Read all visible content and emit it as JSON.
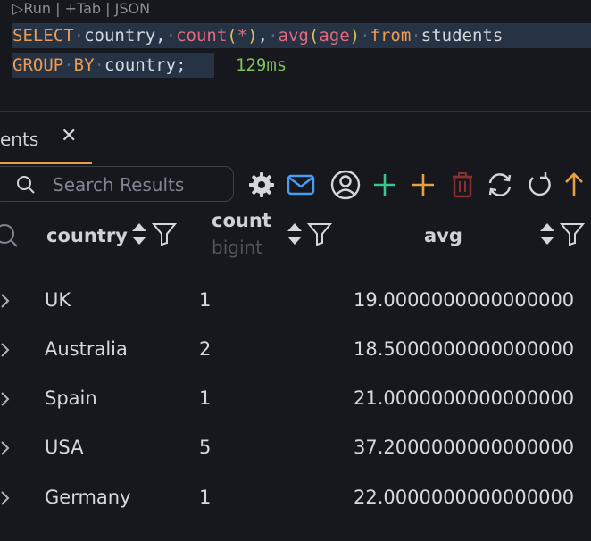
{
  "editor": {
    "codelens": {
      "run": "Run",
      "tab": "Tab",
      "json": "JSON"
    },
    "line1": {
      "select": "SELECT",
      "col": "country,",
      "count_fn": "count",
      "lparen1": "(",
      "star": "*",
      "rparen1": ")",
      "comma": ",",
      "avg_fn": "avg",
      "lparen2": "(",
      "age": "age",
      "rparen2": ")",
      "from": "from",
      "table": "students"
    },
    "line2": {
      "group": "GROUP",
      "by": "BY",
      "col": "country;"
    },
    "exec_time": "129ms"
  },
  "tab": {
    "label": "ents",
    "close": "✕"
  },
  "search": {
    "placeholder": "Search Results"
  },
  "table": {
    "columns": [
      {
        "label": "country",
        "type": ""
      },
      {
        "label": "count",
        "type": "bigint"
      },
      {
        "label": "avg",
        "type": ""
      }
    ],
    "rows": [
      {
        "country": "UK",
        "count": "1",
        "avg": "19.0000000000000000"
      },
      {
        "country": "Australia",
        "count": "2",
        "avg": "18.5000000000000000"
      },
      {
        "country": "Spain",
        "count": "1",
        "avg": "21.0000000000000000"
      },
      {
        "country": "USA",
        "count": "5",
        "avg": "37.2000000000000000"
      },
      {
        "country": "Germany",
        "count": "1",
        "avg": "22.0000000000000000"
      }
    ]
  },
  "colors": {
    "background": "#16181d",
    "keyword": "#ee9b55",
    "function": "#e26a7c",
    "paren": "#e0c04a",
    "exec_time": "#7ec25a",
    "accent": "#e6a040",
    "add_green": "#3bc48e",
    "mail_blue": "#4a9cf0",
    "delete_red": "#8c2f30"
  }
}
